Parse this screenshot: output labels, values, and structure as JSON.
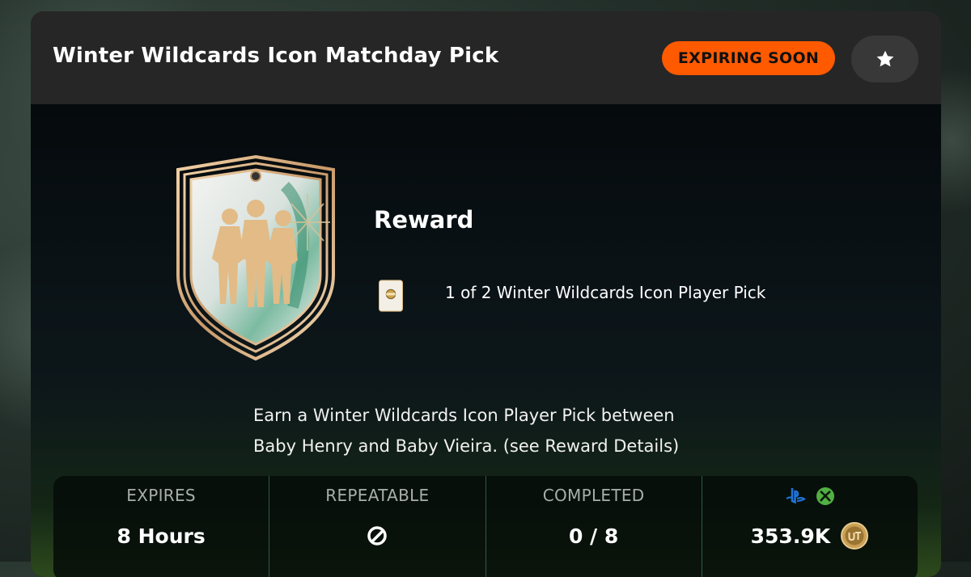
{
  "header": {
    "title": "Winter Wildcards Icon Matchday Pick",
    "badge": "EXPIRING SOON",
    "favorite_icon": "star-icon"
  },
  "reward": {
    "heading": "Reward",
    "item": "1 of 2 Winter Wildcards Icon Player Pick",
    "item_icon": "player-pick-card-icon"
  },
  "description": {
    "line1": "Earn a Winter Wildcards Icon Player Pick between",
    "line2": "Baby Henry and Baby Vieira. (see Reward Details)"
  },
  "stats": {
    "expires": {
      "label": "EXPIRES",
      "value": "8 Hours"
    },
    "repeatable": {
      "label": "REPEATABLE",
      "icon": "infinite-repeat-icon"
    },
    "completed": {
      "label": "COMPLETED",
      "value": "0 / 8"
    },
    "price": {
      "value": "353.9K",
      "platforms": [
        "playstation-icon",
        "xbox-icon"
      ],
      "currency_icon": "ut-coin-icon"
    }
  },
  "colors": {
    "accent": "#ff5a00",
    "header_bg": "#262626",
    "divider": "#2f5a4e"
  }
}
